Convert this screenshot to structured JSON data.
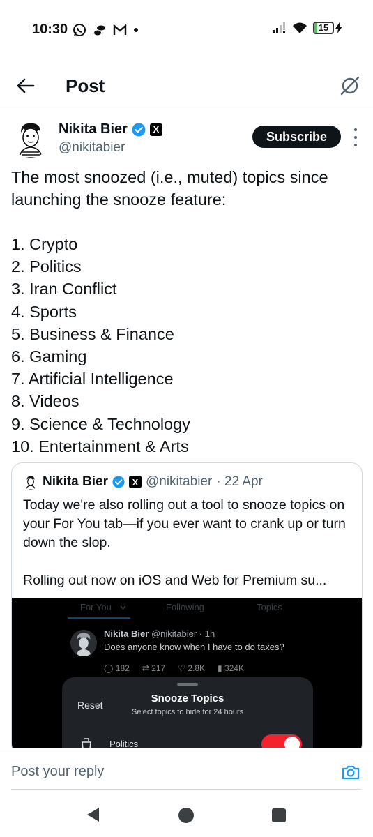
{
  "status_bar": {
    "time": "10:30",
    "left_icons": [
      "whatsapp-icon",
      "infinity-icon",
      "gmail-icon",
      "dot-icon"
    ],
    "right_icons": [
      "signal-icon",
      "wifi-icon",
      "battery-icon"
    ],
    "battery_level": "15",
    "battery_fraction": 0.15,
    "battery_color": "#55c35b"
  },
  "header": {
    "title": "Post",
    "back_icon": "arrow-left-icon",
    "grok_icon": "grok-icon"
  },
  "post": {
    "author_name": "Nikita Bier",
    "author_handle": "@nikitabier",
    "verified_color": "#1d9bf0",
    "affiliate_badge": "X",
    "subscribe_label": "Subscribe",
    "intro": "The most snoozed (i.e., muted) topics since launching the snooze feature:",
    "list": [
      "1. Crypto",
      "2. Politics",
      "3. Iran Conflict",
      "4. Sports",
      "5. Business & Finance",
      "6. Gaming",
      "7. Artificial Intelligence",
      "8. Videos",
      "9. Science & Technology",
      "10. Entertainment & Arts"
    ]
  },
  "quote": {
    "author_name": "Nikita Bier",
    "affiliate_badge": "X",
    "author_handle": "@nikitabier",
    "date": "· 22 Apr",
    "text_1": "Today we're also rolling out a tool to snooze topics on your For You tab—if you ever want to crank up or turn down the slop.",
    "text_2": "Rolling out now on iOS and Web for Premium su...",
    "image": {
      "tabs": [
        "For You",
        "Following",
        "Topics"
      ],
      "inner_name": "Nikita Bier",
      "inner_meta": "@nikitabier · 1h",
      "inner_text": "Does anyone know when I have to do taxes?",
      "stats": [
        "182",
        "217",
        "2.8K",
        "324K"
      ],
      "sheet_reset": "Reset",
      "sheet_title": "Snooze Topics",
      "sheet_subtitle": "Select topics to hide for 24 hours",
      "row_label": "Politics",
      "toggle_on": true,
      "toggle_color": "#f4212e"
    }
  },
  "reply": {
    "placeholder": "Post your reply",
    "camera_icon": "camera-icon",
    "accent": "#1d9bf0"
  },
  "navbar": {
    "icons": [
      "nav-back-icon",
      "nav-home-icon",
      "nav-recents-icon"
    ]
  }
}
